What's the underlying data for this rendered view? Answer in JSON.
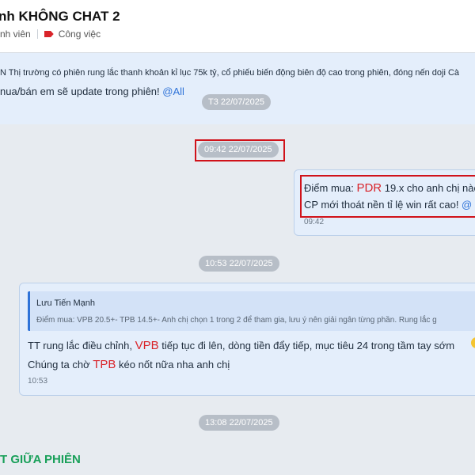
{
  "header": {
    "title": "nh KHÔNG CHAT 2",
    "members_label": "nh viên",
    "tag_label": "Công việc"
  },
  "pinned": {
    "text": "N Thị trường có phiên rung lắc thanh khoản kỉ lục 75k tỷ, cổ phiếu biến động biên độ cao trong phiên, đóng nến doji Cà",
    "line2": "nua/bán em sẽ update trong phiên!",
    "mention": "@All"
  },
  "timestamps": {
    "t1": "T3 22/07/2025",
    "t2": "09:42 22/07/2025",
    "t3": "10:53 22/07/2025",
    "t4": "13:08 22/07/2025"
  },
  "message1": {
    "line1_prefix": "Điểm mua: ",
    "ticker": "PDR",
    "line1_suffix": " 19.x cho anh chị nào",
    "line2_text": "CP mới thoát nền tỉ lệ win rất cao! ",
    "line2_mention": "@",
    "time": "09:42"
  },
  "message2": {
    "quote_author": "Lưu Tiến Mạnh",
    "quote_text": "Điểm mua: VPB 20.5+- TPB 14.5+- Anh chị chọn 1 trong 2 để tham gia, lưu ý nên giải ngân từng phần. Rung lắc g",
    "line1_prefix": "TT rung lắc điều chỉnh, ",
    "ticker1": "VPB",
    "line1_suffix": " tiếp tục đi lên, dòng tiền đẩy tiếp, mục tiêu 24 trong tầm tay sớm",
    "line2_prefix": "Chúng ta chờ ",
    "ticker2": "TPB",
    "line2_suffix": " kéo nốt nữa nha anh chị",
    "time": "10:53"
  },
  "bottom": {
    "title": "T GIỮA PHIÊN"
  }
}
